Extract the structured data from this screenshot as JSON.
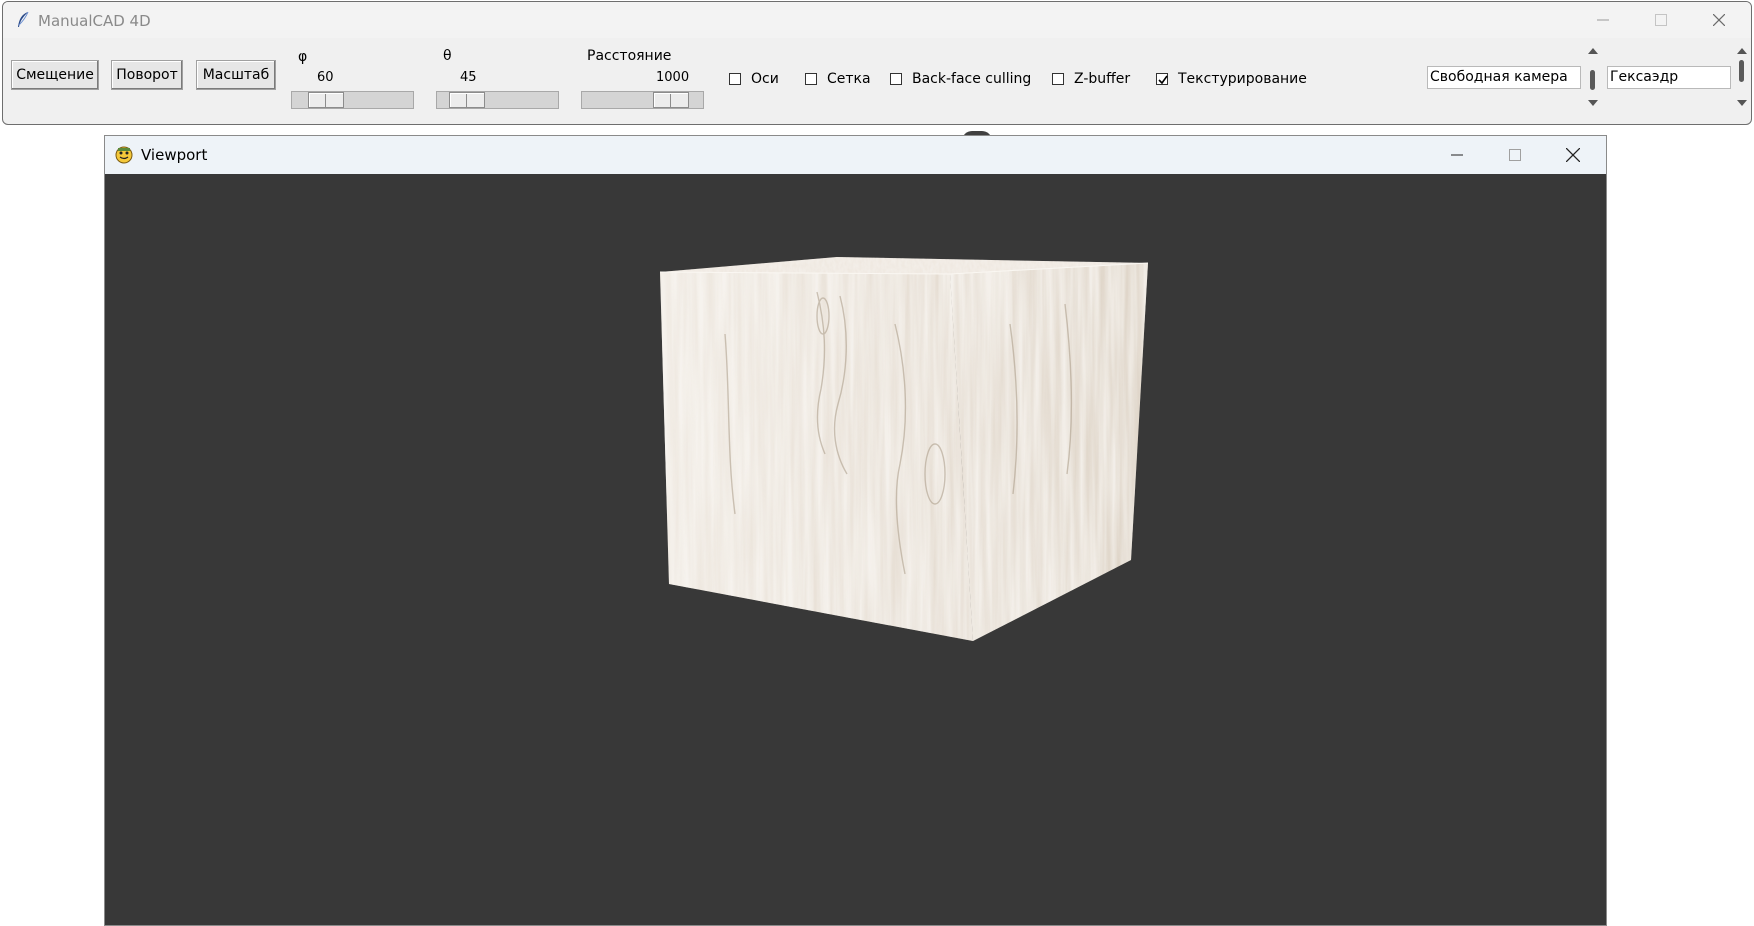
{
  "main_window": {
    "title": "ManualCAD 4D",
    "app_icon": "feather-icon",
    "controls": {
      "minimize": "minimize-icon",
      "maximize": "maximize-icon",
      "close": "close-icon"
    }
  },
  "toolbar": {
    "buttons": [
      {
        "label": "Смещение"
      },
      {
        "label": "Поворот"
      },
      {
        "label": "Масштаб"
      }
    ],
    "scales": [
      {
        "label": "φ",
        "value": "60",
        "level": 0.2
      },
      {
        "label": "θ",
        "value": "45",
        "level": 0.2
      },
      {
        "label": "Расстояние",
        "value": "1000",
        "level": 0.75
      }
    ],
    "checkboxes": [
      {
        "label": "Оси",
        "checked": false
      },
      {
        "label": "Сетка",
        "checked": false
      },
      {
        "label": "Back-face culling",
        "checked": false
      },
      {
        "label": "Z-buffer",
        "checked": false
      },
      {
        "label": "Текстурирование",
        "checked": true
      }
    ],
    "camera_select": {
      "value": "Свободная камера"
    },
    "shape_select": {
      "value": "Гексаэдр"
    }
  },
  "viewport_window": {
    "title": "Viewport",
    "app_icon": "pygame-icon",
    "controls": {
      "minimize": "minimize-icon",
      "maximize": "maximize-icon",
      "close": "close-icon"
    },
    "background": "#383838",
    "scene_object": "textured-cube",
    "texture": "light wood grain"
  },
  "colors": {
    "window_bg": "#f0f0f0",
    "viewport_bg": "#383838",
    "title_bar_viewport": "#eef3f8",
    "wood_light": "#efe9e1",
    "wood_dark": "#b8ab9b"
  }
}
